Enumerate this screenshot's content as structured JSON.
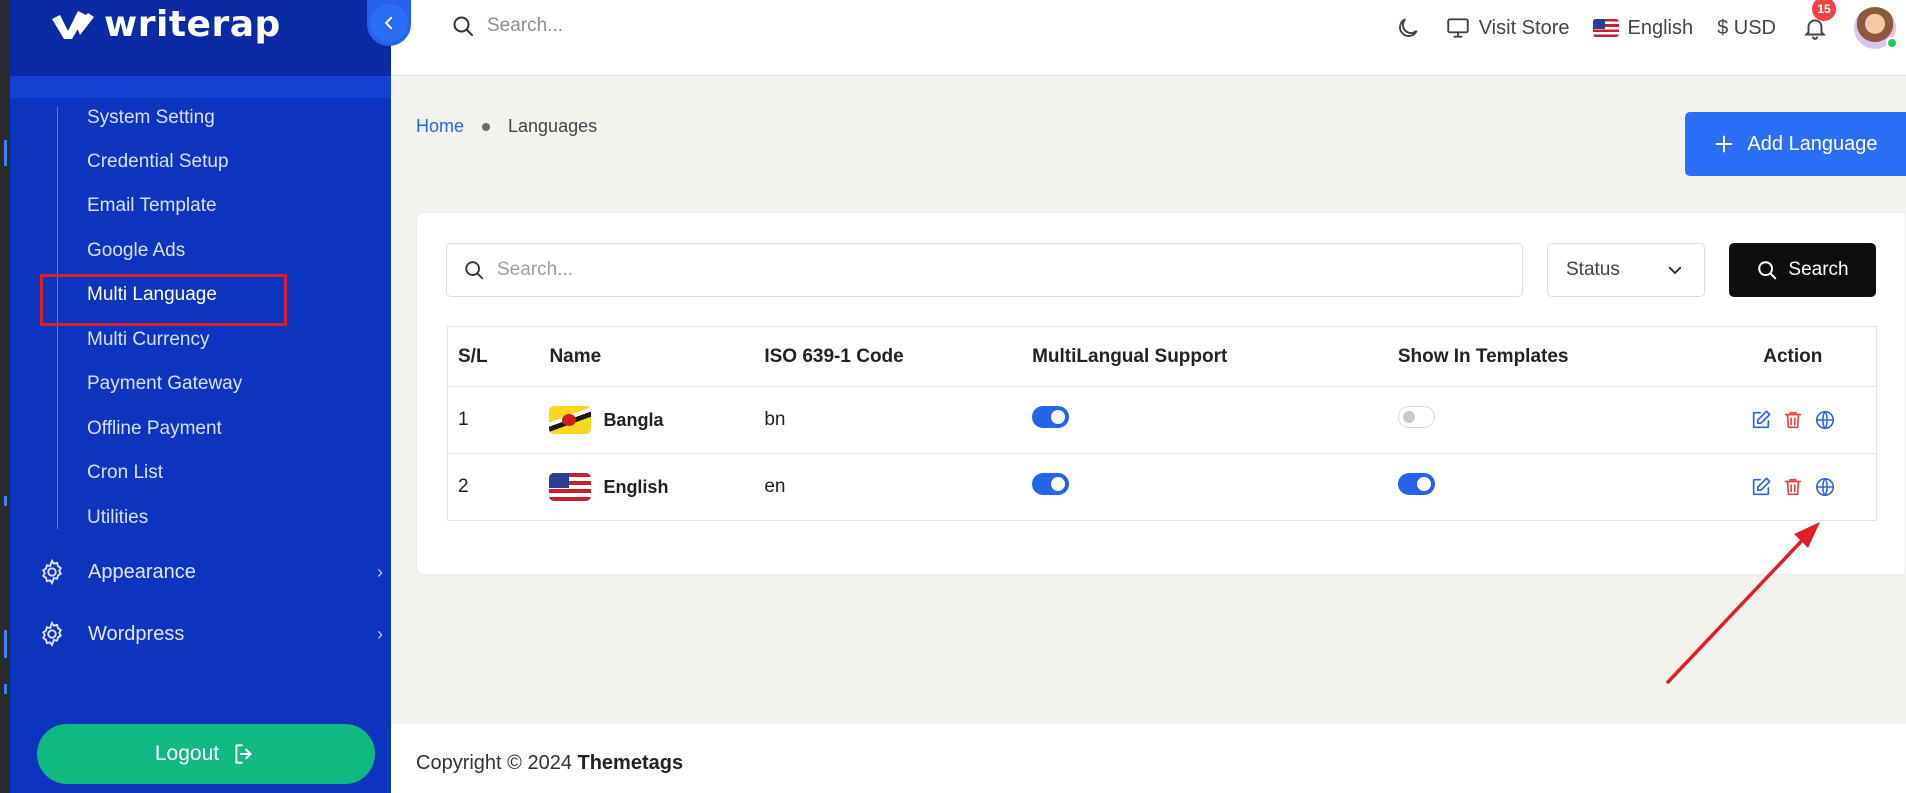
{
  "brand": {
    "name": "writerap"
  },
  "sidebar": {
    "sub_items": [
      {
        "label": "System Setting"
      },
      {
        "label": "Credential Setup"
      },
      {
        "label": "Email Template"
      },
      {
        "label": "Google Ads"
      },
      {
        "label": "Multi Language"
      },
      {
        "label": "Multi Currency"
      },
      {
        "label": "Payment Gateway"
      },
      {
        "label": "Offline Payment"
      },
      {
        "label": "Cron List"
      },
      {
        "label": "Utilities"
      }
    ],
    "groups": [
      {
        "label": "Appearance",
        "icon": "gear-icon"
      },
      {
        "label": "Wordpress",
        "icon": "gear-icon"
      }
    ],
    "logout_label": "Logout"
  },
  "header": {
    "search_placeholder": "Search...",
    "visit_store": "Visit Store",
    "language": "English",
    "currency": "$ USD",
    "notification_count": "15"
  },
  "breadcrumb": {
    "home": "Home",
    "current": "Languages"
  },
  "add_button": "Add Language",
  "filters": {
    "search_placeholder": "Search...",
    "status_label": "Status",
    "search_button": "Search"
  },
  "table": {
    "headers": [
      "S/L",
      "Name",
      "ISO 639-1 Code",
      "MultiLangual Support",
      "Show In Templates",
      "Action"
    ],
    "rows": [
      {
        "sl": "1",
        "name": "Bangla",
        "code": "bn",
        "multilingual": true,
        "show_in_templates": false
      },
      {
        "sl": "2",
        "name": "English",
        "code": "en",
        "multilingual": true,
        "show_in_templates": true
      }
    ]
  },
  "footer": {
    "prefix": "Copyright © 2024",
    "brand": "Themetags"
  },
  "colors": {
    "sidebar": "#0b34c0",
    "primary": "#2a6ef5",
    "logout": "#10b981",
    "annotation": "#e01e26"
  }
}
